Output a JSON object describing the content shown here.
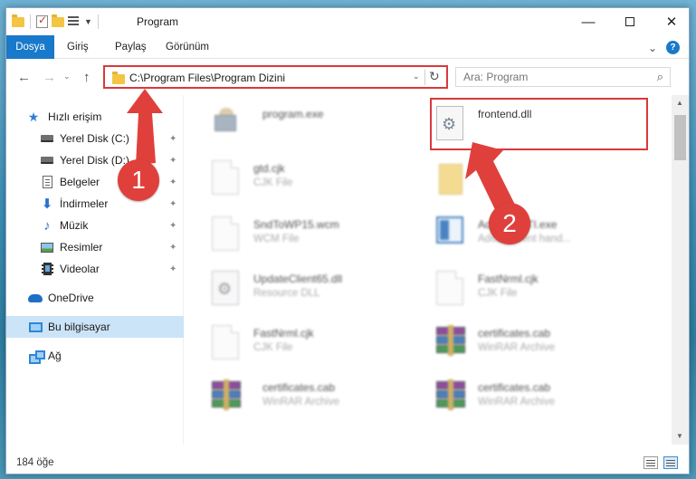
{
  "window": {
    "title": "Program",
    "controls": {
      "minimize": "—",
      "maximize": "",
      "close": "✕"
    }
  },
  "ribbon": {
    "tabs": [
      "Dosya",
      "Giriş",
      "Paylaş",
      "Görünüm"
    ],
    "help": "?",
    "expand": "⌄"
  },
  "nav": {
    "back": "←",
    "forward": "→",
    "recent": "⌄",
    "up": "↑",
    "address_path": "C:\\Program Files\\Program Dizini",
    "address_dropdown": "⌄",
    "refresh": "↻",
    "search_placeholder": "Ara: Program",
    "search_icon": "⌕"
  },
  "sidebar": {
    "items": [
      {
        "label": "Hızlı erişim",
        "icon": "star-icon",
        "pinned": false
      },
      {
        "label": "Yerel Disk (C:)",
        "icon": "drive-icon",
        "pinned": true
      },
      {
        "label": "Yerel Disk (D:)",
        "icon": "drive-icon",
        "pinned": true
      },
      {
        "label": "Belgeler",
        "icon": "document-icon",
        "pinned": true
      },
      {
        "label": "İndirmeler",
        "icon": "download-icon",
        "pinned": true
      },
      {
        "label": "Müzik",
        "icon": "music-icon",
        "pinned": true
      },
      {
        "label": "Resimler",
        "icon": "picture-icon",
        "pinned": true
      },
      {
        "label": "Videolar",
        "icon": "video-icon",
        "pinned": true
      },
      {
        "label": "OneDrive",
        "icon": "cloud-icon",
        "pinned": false
      },
      {
        "label": "Bu bilgisayar",
        "icon": "computer-icon",
        "pinned": false,
        "selected": true
      },
      {
        "label": "Ağ",
        "icon": "network-icon",
        "pinned": false
      }
    ],
    "pin_glyph": "📌"
  },
  "files": [
    {
      "name": "program.exe",
      "type": "",
      "icon": "installer-icon"
    },
    {
      "name": "frontend.dll",
      "type": "",
      "icon": "dll-icon",
      "highlighted": true
    },
    {
      "name": "gtd.cjk",
      "type": "CJK File",
      "icon": "file-icon"
    },
    {
      "name": "",
      "type": "",
      "icon": "folder-document-icon"
    },
    {
      "name": "SndToWP15.wcm",
      "type": "WCM File",
      "icon": "file-icon"
    },
    {
      "name": "AdobeAPITI.exe",
      "type": "Adobe event hand...",
      "icon": "window-app-icon"
    },
    {
      "name": "UpdateClient65.dll",
      "type": "Resource DLL",
      "icon": "dll-icon"
    },
    {
      "name": "FastNrml.cjk",
      "type": "CJK File",
      "icon": "file-icon"
    },
    {
      "name": "FastNrml.cjk",
      "type": "CJK File",
      "icon": "file-icon"
    },
    {
      "name": "certificates.cab",
      "type": "WinRAR Archive",
      "icon": "winrar-icon"
    },
    {
      "name": "certificates.cab",
      "type": "WinRAR Archive",
      "icon": "winrar-icon"
    },
    {
      "name": "certificates.cab",
      "type": "WinRAR Archive",
      "icon": "winrar-icon"
    }
  ],
  "status": {
    "count": "184 öğe"
  },
  "annotations": {
    "step1": "1",
    "step2": "2",
    "color": "#e0403c"
  }
}
